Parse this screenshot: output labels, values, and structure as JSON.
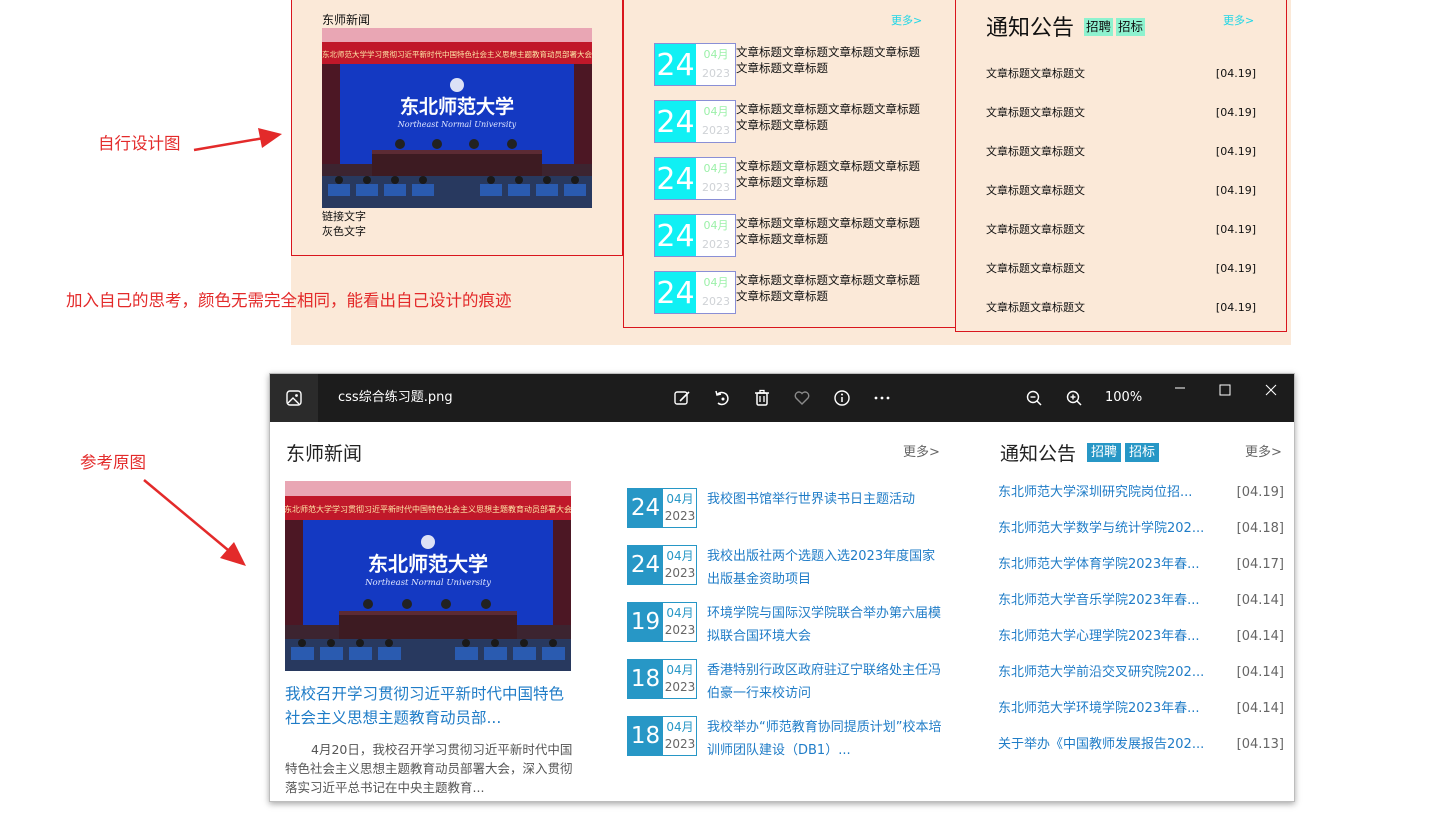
{
  "design": {
    "news_title": "东师新闻",
    "link_text": "链接文字",
    "gray_text": "灰色文字",
    "more": "更多>",
    "articles": [
      {
        "day": "24",
        "month": "04月",
        "year": "2023",
        "title": "文章标题文章标题文章标题文章标题文章标题文章标题"
      },
      {
        "day": "24",
        "month": "04月",
        "year": "2023",
        "title": "文章标题文章标题文章标题文章标题文章标题文章标题"
      },
      {
        "day": "24",
        "month": "04月",
        "year": "2023",
        "title": "文章标题文章标题文章标题文章标题文章标题文章标题"
      },
      {
        "day": "24",
        "month": "04月",
        "year": "2023",
        "title": "文章标题文章标题文章标题文章标题文章标题文章标题"
      },
      {
        "day": "24",
        "month": "04月",
        "year": "2023",
        "title": "文章标题文章标题文章标题文章标题文章标题文章标题"
      }
    ],
    "notice_title": "通知公告",
    "tags": [
      "招聘",
      "招标"
    ],
    "notices": [
      {
        "title": "文章标题文章标题文",
        "date": "[04.19]"
      },
      {
        "title": "文章标题文章标题文",
        "date": "[04.19]"
      },
      {
        "title": "文章标题文章标题文",
        "date": "[04.19]"
      },
      {
        "title": "文章标题文章标题文",
        "date": "[04.19]"
      },
      {
        "title": "文章标题文章标题文",
        "date": "[04.19]"
      },
      {
        "title": "文章标题文章标题文",
        "date": "[04.19]"
      },
      {
        "title": "文章标题文章标题文",
        "date": "[04.19]"
      }
    ]
  },
  "annotations": {
    "self_design": "自行设计图",
    "thinking": "加入自己的思考，颜色无需完全相同，能看出自己设计的痕迹",
    "reference": "参考原图"
  },
  "photo": {
    "banner": "东北师范大学学习贯彻习近平新时代中国特色社会主义思想主题教育动员部署大会",
    "school_name": "东北师范大学",
    "school_en": "Northeast Normal University"
  },
  "viewer": {
    "filename": "css综合练习题.png",
    "zoom": "100%",
    "colors": {
      "toolbar": "#1c1c1c",
      "accent": "#2797c6",
      "link": "#1f7cc7"
    },
    "news_title": "东师新闻",
    "more": "更多>",
    "headline": "我校召开学习贯彻习近平新时代中国特色社会主义思想主题教育动员部...",
    "summary": "4月20日，我校召开学习贯彻习近平新时代中国特色社会主义思想主题教育动员部署大会，深入贯彻落实习近平总书记在中央主题教育...",
    "articles": [
      {
        "day": "24",
        "month": "04月",
        "year": "2023",
        "title": "我校图书馆举行世界读书日主题活动"
      },
      {
        "day": "24",
        "month": "04月",
        "year": "2023",
        "title": "我校出版社两个选题入选2023年度国家出版基金资助项目"
      },
      {
        "day": "19",
        "month": "04月",
        "year": "2023",
        "title": "环境学院与国际汉学院联合举办第六届模拟联合国环境大会"
      },
      {
        "day": "18",
        "month": "04月",
        "year": "2023",
        "title": "香港特别行政区政府驻辽宁联络处主任冯伯豪一行来校访问"
      },
      {
        "day": "18",
        "month": "04月",
        "year": "2023",
        "title": "我校举办“师范教育协同提质计划”校本培训师团队建设（DB1）..."
      }
    ],
    "notice_title": "通知公告",
    "tags": [
      "招聘",
      "招标"
    ],
    "notices": [
      {
        "title": "东北师范大学深圳研究院岗位招...",
        "date": "[04.19]"
      },
      {
        "title": "东北师范大学数学与统计学院202...",
        "date": "[04.18]"
      },
      {
        "title": "东北师范大学体育学院2023年春...",
        "date": "[04.17]"
      },
      {
        "title": "东北师范大学音乐学院2023年春...",
        "date": "[04.14]"
      },
      {
        "title": "东北师范大学心理学院2023年春...",
        "date": "[04.14]"
      },
      {
        "title": "东北师范大学前沿交叉研究院202...",
        "date": "[04.14]"
      },
      {
        "title": "东北师范大学环境学院2023年春...",
        "date": "[04.14]"
      },
      {
        "title": "关于举办《中国教师发展报告202...",
        "date": "[04.13]"
      }
    ]
  }
}
